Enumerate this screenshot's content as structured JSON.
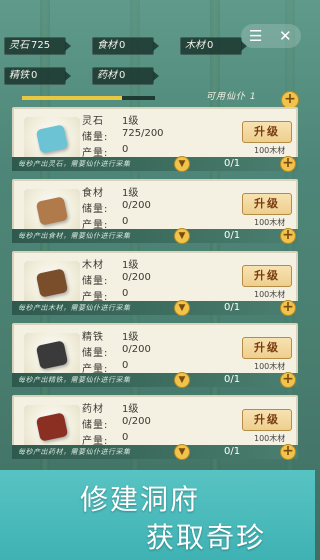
{
  "resources": [
    {
      "label": "灵石",
      "value": "725"
    },
    {
      "label": "食材",
      "value": "0"
    },
    {
      "label": "木材",
      "value": "0"
    },
    {
      "label": "精铁",
      "value": "0"
    },
    {
      "label": "药材",
      "value": "0"
    }
  ],
  "window_buttons": {
    "menu": "☰",
    "close": "✕"
  },
  "progress": {
    "fraction": 0.75
  },
  "hint": {
    "text": "可用仙仆",
    "count": "1"
  },
  "cards": [
    {
      "name": "灵石",
      "level": "1级",
      "store_label": "储量:",
      "store": "725/200",
      "prod_label": "产量:",
      "prod": "0",
      "upgrade": "升级",
      "cost": "100木材",
      "strip_text": "每秒产出灵石，需要仙仆进行采集",
      "assigned": "0/1",
      "thumb_color": "#6cc3d3"
    },
    {
      "name": "食材",
      "level": "1级",
      "store_label": "储量:",
      "store": "0/200",
      "prod_label": "产量:",
      "prod": "0",
      "upgrade": "升级",
      "cost": "100木材",
      "strip_text": "每秒产出食材，需要仙仆进行采集",
      "assigned": "0/1",
      "thumb_color": "#b07a4a"
    },
    {
      "name": "木材",
      "level": "1级",
      "store_label": "储量:",
      "store": "0/200",
      "prod_label": "产量:",
      "prod": "0",
      "upgrade": "升级",
      "cost": "100木材",
      "strip_text": "每秒产出木材，需要仙仆进行采集",
      "assigned": "0/1",
      "thumb_color": "#7a4e2a"
    },
    {
      "name": "精铁",
      "level": "1级",
      "store_label": "储量:",
      "store": "0/200",
      "prod_label": "产量:",
      "prod": "0",
      "upgrade": "升级",
      "cost": "100木材",
      "strip_text": "每秒产出精铁，需要仙仆进行采集",
      "assigned": "0/1",
      "thumb_color": "#3a3a3a"
    },
    {
      "name": "药材",
      "level": "1级",
      "store_label": "储量:",
      "store": "0/200",
      "prod_label": "产量:",
      "prod": "0",
      "upgrade": "升级",
      "cost": "100木材",
      "strip_text": "每秒产出药材，需要仙仆进行采集",
      "assigned": "0/1",
      "thumb_color": "#8a2f22"
    }
  ],
  "banner": {
    "line1": "修建洞府",
    "line2": "获取奇珍"
  }
}
